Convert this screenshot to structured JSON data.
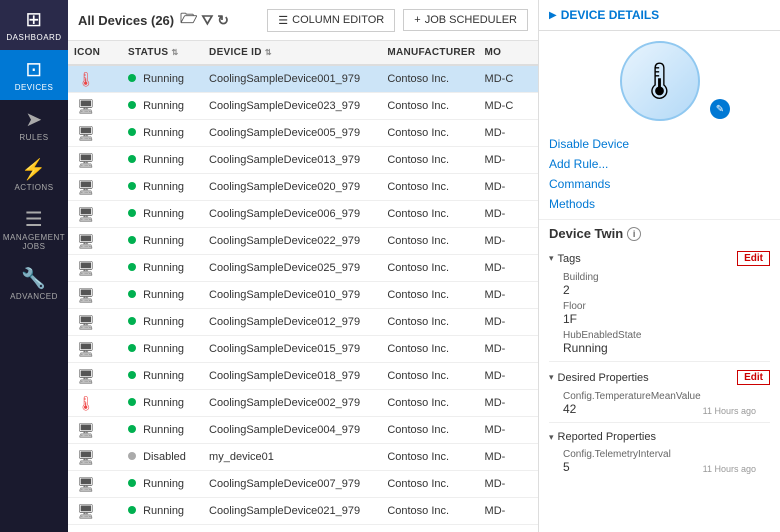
{
  "sidebar": {
    "items": [
      {
        "id": "dashboard",
        "label": "Dashboard",
        "icon": "⊞",
        "active": false
      },
      {
        "id": "devices",
        "label": "Devices",
        "icon": "⊡",
        "active": true
      },
      {
        "id": "rules",
        "label": "Rules",
        "icon": "➤",
        "active": false
      },
      {
        "id": "actions",
        "label": "Actions",
        "icon": "⚡",
        "active": false
      },
      {
        "id": "management-jobs",
        "label": "Management Jobs",
        "icon": "☰",
        "active": false
      },
      {
        "id": "advanced",
        "label": "Advanced",
        "icon": "🔧",
        "active": false
      }
    ]
  },
  "topbar": {
    "title": "All Devices (26)",
    "column_editor_label": "COLUMN EDITOR",
    "job_scheduler_label": "JOB SCHEDULER"
  },
  "table": {
    "columns": [
      "ICON",
      "STATUS",
      "DEVICE ID",
      "MANUFACTURER",
      "MO"
    ],
    "rows": [
      {
        "icon": "thermometer",
        "status": "Running",
        "statusDot": "green",
        "deviceId": "CoolingSampleDevice001_979",
        "manufacturer": "Contoso Inc.",
        "model": "MD-C",
        "selected": true
      },
      {
        "icon": "device",
        "status": "Running",
        "statusDot": "green",
        "deviceId": "CoolingSampleDevice023_979",
        "manufacturer": "Contoso Inc.",
        "model": "MD-C",
        "selected": false
      },
      {
        "icon": "device",
        "status": "Running",
        "statusDot": "green",
        "deviceId": "CoolingSampleDevice005_979",
        "manufacturer": "Contoso Inc.",
        "model": "MD-",
        "selected": false
      },
      {
        "icon": "device",
        "status": "Running",
        "statusDot": "green",
        "deviceId": "CoolingSampleDevice013_979",
        "manufacturer": "Contoso Inc.",
        "model": "MD-",
        "selected": false
      },
      {
        "icon": "device",
        "status": "Running",
        "statusDot": "green",
        "deviceId": "CoolingSampleDevice020_979",
        "manufacturer": "Contoso Inc.",
        "model": "MD-",
        "selected": false
      },
      {
        "icon": "device",
        "status": "Running",
        "statusDot": "green",
        "deviceId": "CoolingSampleDevice006_979",
        "manufacturer": "Contoso Inc.",
        "model": "MD-",
        "selected": false
      },
      {
        "icon": "device",
        "status": "Running",
        "statusDot": "green",
        "deviceId": "CoolingSampleDevice022_979",
        "manufacturer": "Contoso Inc.",
        "model": "MD-",
        "selected": false
      },
      {
        "icon": "device",
        "status": "Running",
        "statusDot": "green",
        "deviceId": "CoolingSampleDevice025_979",
        "manufacturer": "Contoso Inc.",
        "model": "MD-",
        "selected": false
      },
      {
        "icon": "device",
        "status": "Running",
        "statusDot": "green",
        "deviceId": "CoolingSampleDevice010_979",
        "manufacturer": "Contoso Inc.",
        "model": "MD-",
        "selected": false
      },
      {
        "icon": "device",
        "status": "Running",
        "statusDot": "green",
        "deviceId": "CoolingSampleDevice012_979",
        "manufacturer": "Contoso Inc.",
        "model": "MD-",
        "selected": false
      },
      {
        "icon": "device",
        "status": "Running",
        "statusDot": "green",
        "deviceId": "CoolingSampleDevice015_979",
        "manufacturer": "Contoso Inc.",
        "model": "MD-",
        "selected": false
      },
      {
        "icon": "device",
        "status": "Running",
        "statusDot": "green",
        "deviceId": "CoolingSampleDevice018_979",
        "manufacturer": "Contoso Inc.",
        "model": "MD-",
        "selected": false
      },
      {
        "icon": "thermometer",
        "status": "Running",
        "statusDot": "green",
        "deviceId": "CoolingSampleDevice002_979",
        "manufacturer": "Contoso Inc.",
        "model": "MD-",
        "selected": false
      },
      {
        "icon": "device",
        "status": "Running",
        "statusDot": "green",
        "deviceId": "CoolingSampleDevice004_979",
        "manufacturer": "Contoso Inc.",
        "model": "MD-",
        "selected": false
      },
      {
        "icon": "device",
        "status": "Disabled",
        "statusDot": "gray",
        "deviceId": "my_device01",
        "manufacturer": "Contoso Inc.",
        "model": "MD-",
        "selected": false
      },
      {
        "icon": "device",
        "status": "Running",
        "statusDot": "green",
        "deviceId": "CoolingSampleDevice007_979",
        "manufacturer": "Contoso Inc.",
        "model": "MD-",
        "selected": false
      },
      {
        "icon": "device",
        "status": "Running",
        "statusDot": "green",
        "deviceId": "CoolingSampleDevice021_979",
        "manufacturer": "Contoso Inc.",
        "model": "MD-",
        "selected": false
      }
    ]
  },
  "panel": {
    "header_title": "DEVICE DETAILS",
    "device_icon": "🌡",
    "actions": [
      {
        "id": "disable-device",
        "label": "Disable Device"
      },
      {
        "id": "add-rule",
        "label": "Add Rule..."
      },
      {
        "id": "commands",
        "label": "Commands"
      },
      {
        "id": "methods",
        "label": "Methods"
      }
    ],
    "device_twin_title": "Device Twin",
    "tags_section": {
      "label": "Tags",
      "edit_label": "Edit",
      "fields": [
        {
          "label": "Building",
          "value": "2"
        },
        {
          "label": "Floor",
          "value": "1F"
        },
        {
          "label": "HubEnabledState",
          "value": "Running"
        }
      ]
    },
    "desired_properties_section": {
      "label": "Desired Properties",
      "edit_label": "Edit",
      "fields": [
        {
          "label": "Config.TemperatureMeanValue",
          "value": "42",
          "meta": "11 Hours ago"
        }
      ]
    },
    "reported_properties_section": {
      "label": "Reported Properties",
      "fields": [
        {
          "label": "Config.TelemetryInterval",
          "value": "5",
          "meta": "11 Hours ago"
        }
      ]
    }
  }
}
